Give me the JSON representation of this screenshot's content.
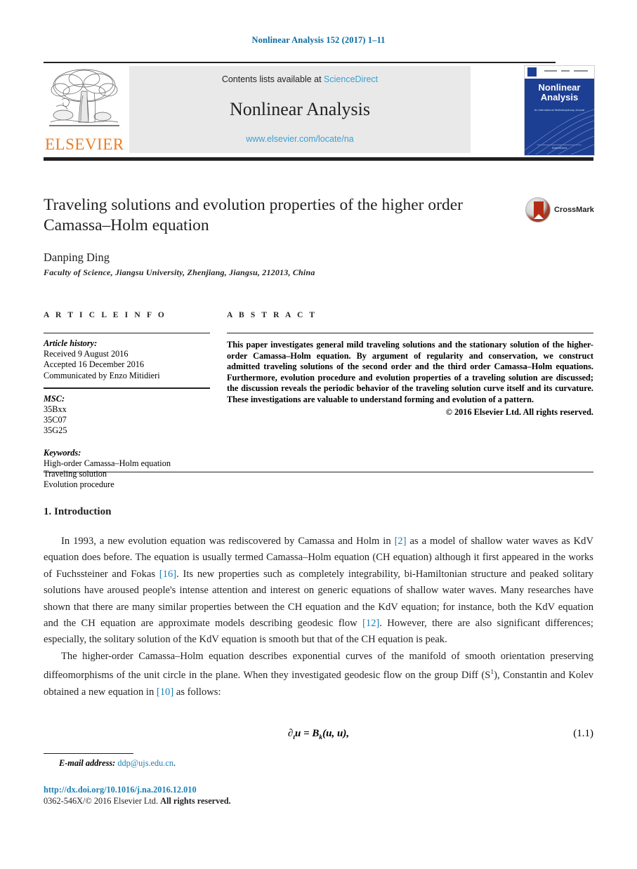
{
  "running_head": "Nonlinear Analysis 152 (2017) 1–11",
  "banner": {
    "publisher_name": "ELSEVIER",
    "publisher_logo_icon": "elsevier-tree-icon",
    "contents_prefix": "Contents lists available at ",
    "sciencedirect_link": "ScienceDirect",
    "journal_title": "Nonlinear Analysis",
    "journal_url": "www.elsevier.com/locate/na",
    "cover": {
      "title_line1": "Nonlinear",
      "title_line2": "Analysis",
      "subtitle_lines": "An International Multidisciplinary Journal",
      "footer_text": "ScienceDirect"
    }
  },
  "article": {
    "title": "Traveling solutions and evolution properties of the higher order Camassa–Holm equation",
    "crossmark_label": "CrossMark",
    "crossmark_icon": "crossmark-icon",
    "author": "Danping Ding",
    "affiliation": "Faculty of Science, Jiangsu University, Zhenjiang, Jiangsu, 212013, China"
  },
  "info": {
    "heading": "A R T I C L E   I N F O",
    "history_label": "Article history:",
    "history_lines": [
      "Received 9 August 2016",
      "Accepted 16 December 2016",
      "Communicated by Enzo Mitidieri"
    ],
    "msc_label": "MSC:",
    "msc_codes": [
      "35Bxx",
      "35C07",
      "35G25"
    ],
    "keywords_label": "Keywords:",
    "keywords": [
      "High-order Camassa–Holm equation",
      "Traveling solution",
      "Evolution procedure"
    ]
  },
  "abstract": {
    "heading": "A B S T R A C T",
    "body": "This paper investigates general mild traveling solutions and the stationary solution of the higher-order Camassa–Holm equation. By argument of regularity and conservation, we construct admitted traveling solutions of the second order and the third order Camassa–Holm equations. Furthermore, evolution procedure and evolution properties of a traveling solution are discussed; the discussion reveals the periodic behavior of the traveling solution curve itself and its curvature. These investigations are valuable to understand forming and evolution of a pattern.",
    "copyright": "© 2016 Elsevier Ltd. All rights reserved."
  },
  "body": {
    "section_heading": "1.  Introduction",
    "para1_a": "In 1993, a new evolution equation was rediscovered by Camassa and Holm in ",
    "para1_ref1": "[2]",
    "para1_b": " as a model of shallow water waves as KdV equation does before. The equation is usually termed Camassa–Holm equation (CH equation) although it first appeared in the works of Fuchssteiner and Fokas ",
    "para1_ref2": "[16]",
    "para1_c": ". Its new properties such as completely integrability, bi-Hamiltonian structure and peaked solitary solutions have aroused people's intense attention and interest on generic equations of shallow water waves. Many researches have shown that there are many similar properties between the CH equation and the KdV equation; for instance, both the KdV equation and the CH equation are approximate models describing geodesic flow ",
    "para1_ref3": "[12]",
    "para1_d": ". However, there are also significant differences; especially, the solitary solution of the KdV equation is smooth but that of the CH equation is peak.",
    "para2_a": "The higher-order Camassa–Holm equation describes exponential curves of the manifold of smooth orientation preserving diffeomorphisms of the unit circle in the plane. When they investigated geodesic flow on the group Diff (S",
    "para2_sup": "1",
    "para2_b": "), Constantin and Kolev obtained a new equation in ",
    "para2_ref": "[10]",
    "para2_c": " as follows:",
    "equation_lhs": "∂",
    "equation_lhs_sub": "t",
    "equation_body": "u = B",
    "equation_body_sub": "k",
    "equation_tail": "(u, u),",
    "equation_number": "(1.1)"
  },
  "footer": {
    "email_label": "E-mail address:",
    "email": "ddp@ujs.edu.cn",
    "email_suffix": ".",
    "doi": "http://dx.doi.org/10.1016/j.na.2016.12.010",
    "issn_prefix": "0362-546X/© 2016 Elsevier Ltd. ",
    "issn_suffix": "All rights reserved."
  },
  "colors": {
    "link_blue": "#1a7fb5",
    "banner_blue": "#3aa0d1",
    "elsevier_orange": "#ec7d24",
    "cover_blue": "#1d3f93",
    "crossmark_red": "#b32d16"
  }
}
